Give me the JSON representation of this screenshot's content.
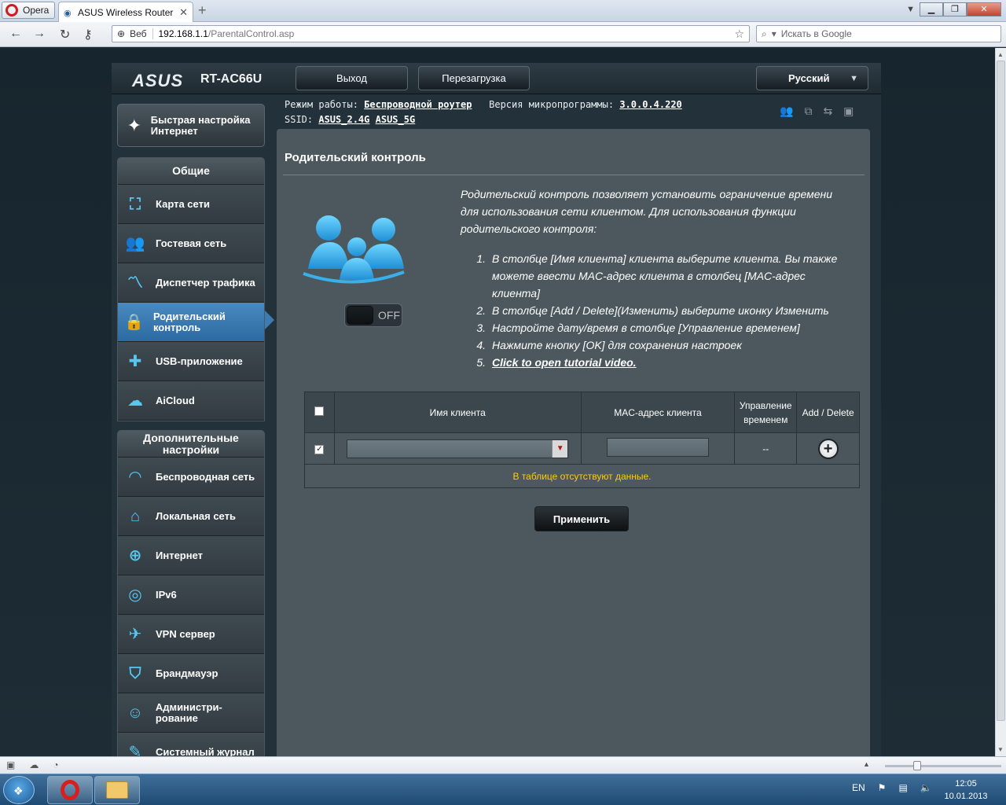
{
  "browser": {
    "menu_label": "Opera",
    "tab_title": "ASUS Wireless Router R...",
    "address_prefix": "Веб",
    "url_host": "192.168.1.1",
    "url_path": "/ParentalControl.asp",
    "search_placeholder": "Искать в Google"
  },
  "router": {
    "brand": "ASUS",
    "model": "RT-AC66U",
    "logout_label": "Выход",
    "reboot_label": "Перезагрузка",
    "language": "Русский",
    "mode_label": "Режим работы:",
    "mode_value": "Беспроводной роутер",
    "firmware_label": "Версия микропрограммы:",
    "firmware_value": "3.0.0.4.220",
    "ssid_label": "SSID:",
    "ssid_24": "ASUS_2.4G",
    "ssid_5": "ASUS_5G"
  },
  "sidebar": {
    "quick_setup": "Быстрая настройка Интернет",
    "general_header": "Общие",
    "general_items": [
      {
        "label": "Карта сети",
        "icon": "network-map-icon"
      },
      {
        "label": "Гостевая сеть",
        "icon": "guest-network-icon"
      },
      {
        "label": "Диспетчер трафика",
        "icon": "traffic-manager-icon"
      },
      {
        "label": "Родительский контроль",
        "icon": "parental-control-icon",
        "active": true
      },
      {
        "label": "USB-приложение",
        "icon": "usb-app-icon"
      },
      {
        "label": "AiCloud",
        "icon": "aicloud-icon"
      }
    ],
    "advanced_header": "Дополнительные настройки",
    "advanced_items": [
      {
        "label": "Беспроводная сеть",
        "icon": "wireless-icon"
      },
      {
        "label": "Локальная сеть",
        "icon": "lan-icon"
      },
      {
        "label": "Интернет",
        "icon": "wan-icon"
      },
      {
        "label": "IPv6",
        "icon": "ipv6-icon"
      },
      {
        "label": "VPN сервер",
        "icon": "vpn-icon"
      },
      {
        "label": "Брандмауэр",
        "icon": "firewall-icon"
      },
      {
        "label": "Администри-рование",
        "icon": "admin-icon"
      },
      {
        "label": "Системный журнал",
        "icon": "syslog-icon"
      }
    ]
  },
  "content": {
    "title": "Родительский контроль",
    "toggle_state": "OFF",
    "description": "Родительский контроль позволяет установить ограничение времени для использования сети клиентом. Для использования функции родительского контроля:",
    "steps": [
      "В столбце [Имя клиента] клиента выберите клиента. Вы также можете ввести MAC-адрес клиента в столбец [MAC-адрес клиента]",
      "В столбце [Add / Delete](Изменить) выберите иконку Изменить",
      "Настройте дату/время в столбце [Управление временем]",
      "Нажмите кнопку [OK] для сохранения настроек",
      "Click to open tutorial video."
    ],
    "table": {
      "col_client": "Имя клиента",
      "col_mac": "MAC-адрес клиента",
      "col_time": "Управление временем",
      "col_add": "Add / Delete",
      "time_placeholder": "--",
      "empty_message": "В таблице отсутствуют данные."
    },
    "apply_label": "Применить"
  },
  "taskbar": {
    "lang": "EN",
    "time": "12:05",
    "date": "10.01.2013"
  }
}
